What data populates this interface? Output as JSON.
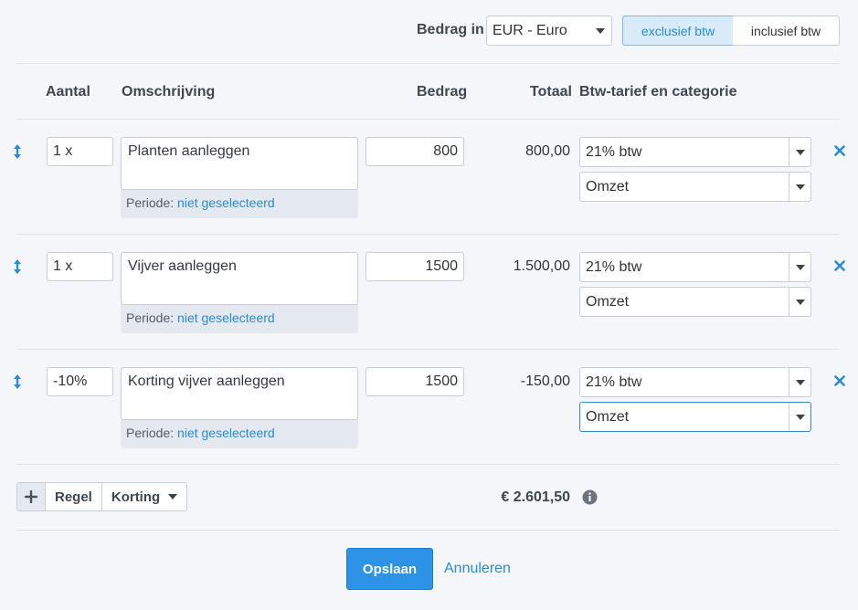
{
  "header": {
    "bedrag_in_label": "Bedrag in",
    "currency": "EUR - Euro",
    "toggle_excl": "exclusief btw",
    "toggle_incl": "inclusief btw",
    "active_toggle": "exclusief btw"
  },
  "columns": {
    "aantal": "Aantal",
    "omschrijving": "Omschrijving",
    "bedrag": "Bedrag",
    "totaal": "Totaal",
    "btw": "Btw-tarief en categorie"
  },
  "rows": [
    {
      "aantal": "1 x",
      "omschrijving": "Planten aanleggen",
      "periode_label": "Periode:",
      "periode_value": "niet geselecteerd",
      "bedrag": "800",
      "totaal": "800,00",
      "btw": "21% btw",
      "categorie": "Omzet"
    },
    {
      "aantal": "1 x",
      "omschrijving": "Vijver aanleggen",
      "periode_label": "Periode:",
      "periode_value": "niet geselecteerd",
      "bedrag": "1500",
      "totaal": "1.500,00",
      "btw": "21% btw",
      "categorie": "Omzet"
    },
    {
      "aantal": "-10%",
      "omschrijving": "Korting vijver aanleggen",
      "periode_label": "Periode:",
      "periode_value": "niet geselecteerd",
      "bedrag": "1500",
      "totaal": "-150,00",
      "btw": "21% btw",
      "categorie": "Omzet"
    }
  ],
  "footer": {
    "regel_label": "Regel",
    "korting_label": "Korting",
    "grand_total": "€ 2.601,50",
    "save_label": "Opslaan",
    "cancel_label": "Annuleren"
  },
  "colors": {
    "accent": "#2a8bd6",
    "primary_button": "#2d93e6",
    "background": "#f4f6f9"
  },
  "icons": [
    "drag-handle-icon",
    "remove-icon",
    "plus-icon",
    "info-icon",
    "caret-down-icon"
  ]
}
